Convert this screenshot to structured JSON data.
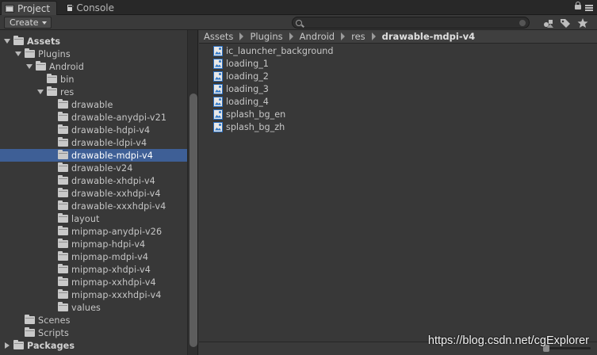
{
  "tabs": [
    {
      "label": "Project",
      "active": true
    },
    {
      "label": "Console",
      "active": false
    }
  ],
  "toolbar": {
    "create_label": "Create",
    "search_placeholder": "",
    "search_value": ""
  },
  "tree": {
    "items": [
      {
        "label": "Assets",
        "depth": 0,
        "state": "open",
        "bold": true,
        "selected": false
      },
      {
        "label": "Plugins",
        "depth": 1,
        "state": "open",
        "bold": false,
        "selected": false
      },
      {
        "label": "Android",
        "depth": 2,
        "state": "open",
        "bold": false,
        "selected": false
      },
      {
        "label": "bin",
        "depth": 3,
        "state": "none",
        "bold": false,
        "selected": false
      },
      {
        "label": "res",
        "depth": 3,
        "state": "open",
        "bold": false,
        "selected": false
      },
      {
        "label": "drawable",
        "depth": 4,
        "state": "none",
        "bold": false,
        "selected": false
      },
      {
        "label": "drawable-anydpi-v21",
        "depth": 4,
        "state": "none",
        "bold": false,
        "selected": false
      },
      {
        "label": "drawable-hdpi-v4",
        "depth": 4,
        "state": "none",
        "bold": false,
        "selected": false
      },
      {
        "label": "drawable-ldpi-v4",
        "depth": 4,
        "state": "none",
        "bold": false,
        "selected": false
      },
      {
        "label": "drawable-mdpi-v4",
        "depth": 4,
        "state": "none",
        "bold": false,
        "selected": true
      },
      {
        "label": "drawable-v24",
        "depth": 4,
        "state": "none",
        "bold": false,
        "selected": false
      },
      {
        "label": "drawable-xhdpi-v4",
        "depth": 4,
        "state": "none",
        "bold": false,
        "selected": false
      },
      {
        "label": "drawable-xxhdpi-v4",
        "depth": 4,
        "state": "none",
        "bold": false,
        "selected": false
      },
      {
        "label": "drawable-xxxhdpi-v4",
        "depth": 4,
        "state": "none",
        "bold": false,
        "selected": false
      },
      {
        "label": "layout",
        "depth": 4,
        "state": "none",
        "bold": false,
        "selected": false
      },
      {
        "label": "mipmap-anydpi-v26",
        "depth": 4,
        "state": "none",
        "bold": false,
        "selected": false
      },
      {
        "label": "mipmap-hdpi-v4",
        "depth": 4,
        "state": "none",
        "bold": false,
        "selected": false
      },
      {
        "label": "mipmap-mdpi-v4",
        "depth": 4,
        "state": "none",
        "bold": false,
        "selected": false
      },
      {
        "label": "mipmap-xhdpi-v4",
        "depth": 4,
        "state": "none",
        "bold": false,
        "selected": false
      },
      {
        "label": "mipmap-xxhdpi-v4",
        "depth": 4,
        "state": "none",
        "bold": false,
        "selected": false
      },
      {
        "label": "mipmap-xxxhdpi-v4",
        "depth": 4,
        "state": "none",
        "bold": false,
        "selected": false
      },
      {
        "label": "values",
        "depth": 4,
        "state": "none",
        "bold": false,
        "selected": false
      },
      {
        "label": "Scenes",
        "depth": 1,
        "state": "none",
        "bold": false,
        "selected": false
      },
      {
        "label": "Scripts",
        "depth": 1,
        "state": "none",
        "bold": false,
        "selected": false
      },
      {
        "label": "Packages",
        "depth": 0,
        "state": "closed",
        "bold": true,
        "selected": false
      }
    ]
  },
  "breadcrumb": [
    "Assets",
    "Plugins",
    "Android",
    "res",
    "drawable-mdpi-v4"
  ],
  "files": [
    {
      "label": "ic_launcher_background",
      "icon": "image-icon"
    },
    {
      "label": "loading_1",
      "icon": "image-icon"
    },
    {
      "label": "loading_2",
      "icon": "image-icon"
    },
    {
      "label": "loading_3",
      "icon": "image-icon"
    },
    {
      "label": "loading_4",
      "icon": "image-icon"
    },
    {
      "label": "splash_bg_en",
      "icon": "image-icon"
    },
    {
      "label": "splash_bg_zh",
      "icon": "image-icon"
    }
  ],
  "watermark": "https://blog.csdn.net/cgExplorer",
  "colors": {
    "selection": "#3e5f96",
    "background": "#383838",
    "image_icon_accent": "#2f78c9"
  }
}
